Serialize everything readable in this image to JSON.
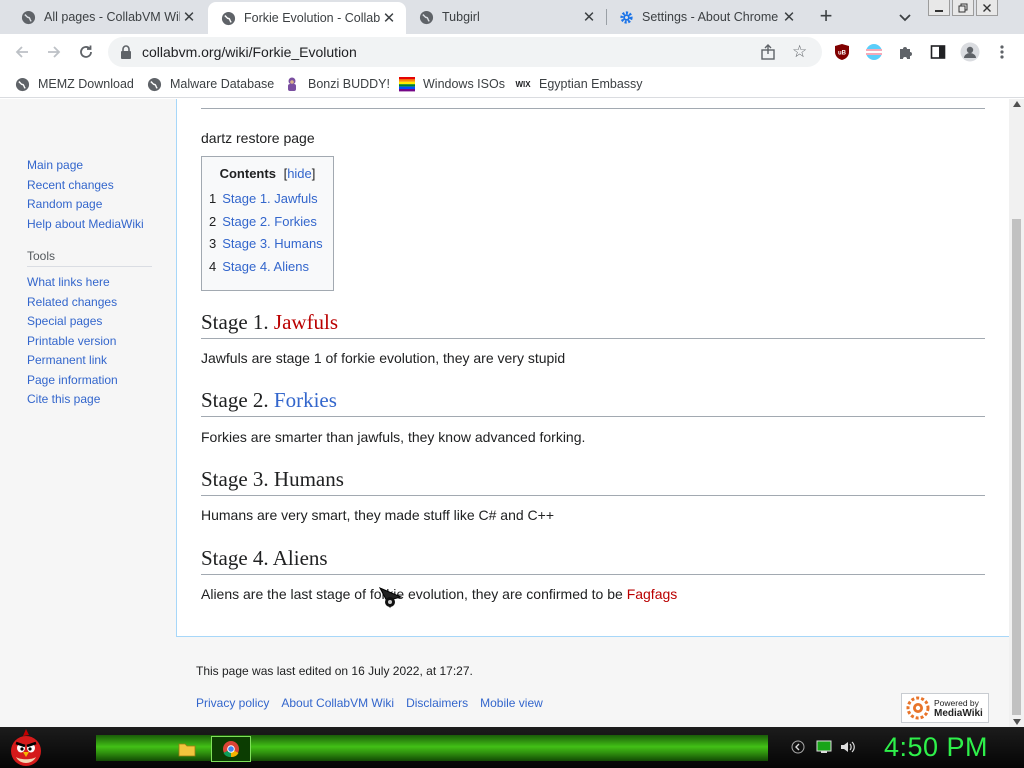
{
  "browser": {
    "tabs": [
      {
        "title": "All pages - CollabVM Wiki",
        "active": false
      },
      {
        "title": "Forkie Evolution - CollabVM",
        "active": true
      },
      {
        "title": "Tubgirl",
        "active": false
      },
      {
        "title": "Settings - About Chrome",
        "active": false
      }
    ],
    "newtab_glyph": "+",
    "close_glyph": "✕",
    "url": "collabvm.org/wiki/Forkie_Evolution",
    "bookmarks": [
      {
        "label": "MEMZ Download",
        "icon": "globe-icon"
      },
      {
        "label": "Malware Database",
        "icon": "globe-icon"
      },
      {
        "label": "Bonzi BUDDY!",
        "icon": "bonzi-icon"
      },
      {
        "label": "Windows ISOs",
        "icon": "windows-flag-icon"
      },
      {
        "label": "Egyptian Embassy",
        "icon": "wix-icon"
      }
    ],
    "wix_text": "WIX"
  },
  "sidebar": {
    "nav": [
      "Main page",
      "Recent changes",
      "Random page",
      "Help about MediaWiki"
    ],
    "tools_heading": "Tools",
    "tools": [
      "What links here",
      "Related changes",
      "Special pages",
      "Printable version",
      "Permanent link",
      "Page information",
      "Cite this page"
    ]
  },
  "article": {
    "intro": "dartz restore page",
    "toc": {
      "heading": "Contents",
      "toggle_open": "[",
      "toggle": "hide",
      "toggle_close": "]",
      "items": [
        {
          "num": "1",
          "text": "Stage 1. Jawfuls"
        },
        {
          "num": "2",
          "text": "Stage 2. Forkies"
        },
        {
          "num": "3",
          "text": "Stage 3. Humans"
        },
        {
          "num": "4",
          "text": "Stage 4. Aliens"
        }
      ]
    },
    "sections": [
      {
        "prefix": "Stage 1. ",
        "link": "Jawfuls",
        "text": "Jawfuls are stage 1 of forkie evolution, they are very stupid"
      },
      {
        "prefix": "Stage 2. ",
        "link": "Forkies",
        "text": "Forkies are smarter than jawfuls, they know advanced forking."
      },
      {
        "prefix": "Stage 3. Humans",
        "text": "Humans are very smart, they made stuff like C# and C++"
      },
      {
        "prefix": "Stage 4. Aliens",
        "text": "Aliens are the last stage of forkie evolution, they are confirmed to be ",
        "text_link": "Fagfags"
      }
    ]
  },
  "footer": {
    "last_edited": "This page was last edited on 16 July 2022, at 17:27.",
    "links": [
      "Privacy policy",
      "About CollabVM Wiki",
      "Disclaimers",
      "Mobile view"
    ],
    "powered_line1": "Powered by",
    "powered_line2": "MediaWiki"
  },
  "taskbar": {
    "clock": "4:50 PM"
  },
  "colors": {
    "link": "#3366cc",
    "redlink": "#ba0000",
    "clock": "#2ef04a"
  }
}
